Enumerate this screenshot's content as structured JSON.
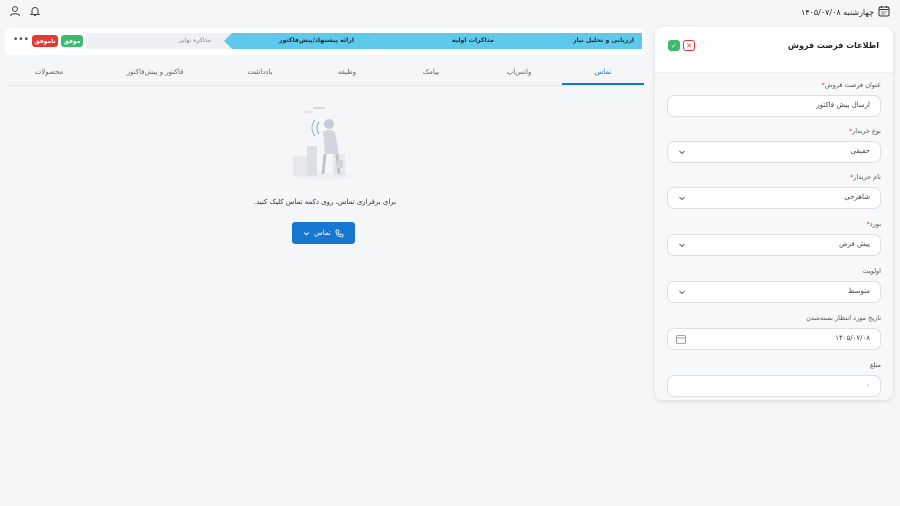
{
  "header": {
    "date": "چهارشنبه ۱۴۰۵/۰۷/۰۸",
    "calendar_icon": "calendar-icon",
    "bell_icon": "bell-icon",
    "user_icon": "user-icon"
  },
  "panel": {
    "title": "اطلاعات فرصت فروش",
    "fields": [
      {
        "label": "عنوان فرصت فروش",
        "required": "*",
        "value": "ارسال پیش فاکتور"
      },
      {
        "label": "نوع خریدار",
        "required": "*",
        "value": "حقیقی"
      },
      {
        "label": "نام خریدار",
        "required": "*",
        "value": "شاهرخی"
      },
      {
        "label": "بورد",
        "required": "*",
        "value": "پیش فرض"
      },
      {
        "label": "اولویت",
        "required": "",
        "value": "متوسط"
      },
      {
        "label": "تاریخ مورد انتظار بسته‌شدن",
        "required": "",
        "value": "۱۴۰۵/۰۷/۰۸"
      },
      {
        "label": "مبلغ",
        "required": "",
        "value": "۰"
      }
    ]
  },
  "stages": [
    "ارزیابی و تحلیل نیاز",
    "مذاکرات اولیه",
    "ارائه پیشنهاد/پیش‌فاکتور",
    "مذاکره نهایی"
  ],
  "badges": {
    "success": "موفق",
    "fail": "ناموفق"
  },
  "tabs": [
    "تماس",
    "واتس‌اپ",
    "پیامک",
    "وظیفه",
    "یادداشت",
    "فاکتور و پیش‌فاکتور",
    "محصولات"
  ],
  "empty_state": {
    "message": "برای برقراری تماس، روی دکمه تماس کلیک کنید.",
    "button_label": "تماس"
  },
  "colors": {
    "accent": "#1677d2",
    "stage_fill": "#5ec9ea",
    "success": "#3dbb6a",
    "fail": "#e53935"
  }
}
